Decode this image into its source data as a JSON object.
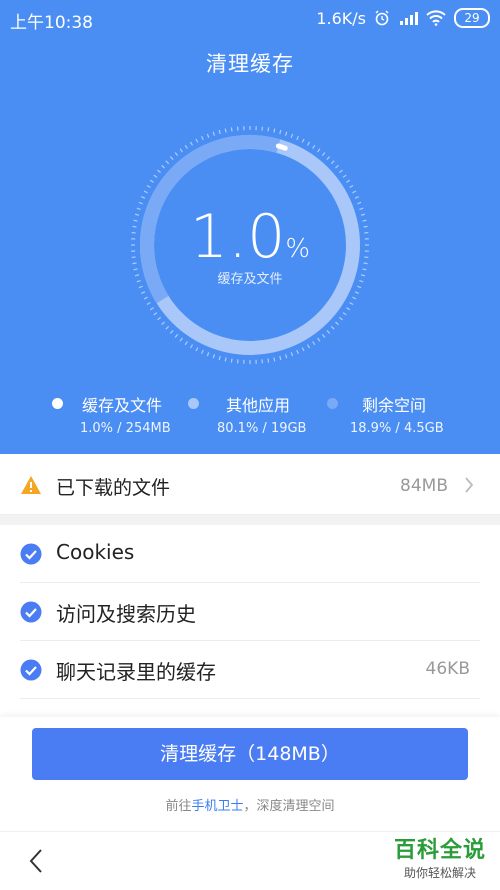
{
  "status": {
    "time": "上午10:38",
    "net_speed": "1.6K/s",
    "battery": "29"
  },
  "title": "清理缓存",
  "gauge": {
    "percent": "1.0",
    "percent_sign": "%",
    "label": "缓存及文件",
    "fill_fraction": 0.01
  },
  "legend": [
    {
      "name": "缓存及文件",
      "value": "1.0% / 254MB"
    },
    {
      "name": "其他应用",
      "value": "80.1% / 19GB"
    },
    {
      "name": "剩余空间",
      "value": "18.9% / 4.5GB"
    }
  ],
  "downloads": {
    "label": "已下载的文件",
    "size": "84MB"
  },
  "items": [
    {
      "label": "Cookies",
      "size": ""
    },
    {
      "label": "访问及搜索历史",
      "size": ""
    },
    {
      "label": "聊天记录里的缓存",
      "size": "46KB"
    },
    {
      "label": "",
      "size": ""
    }
  ],
  "clean_button": "清理缓存（148MB）",
  "hint": {
    "prefix": "前往",
    "link": "手机卫士",
    "suffix": "，深度清理空间"
  },
  "watermark": {
    "title": "百科全说",
    "subtitle": "助你轻松解决"
  },
  "colors": {
    "header": "#4a8ef4",
    "button": "#4a7df3",
    "accent": "#3b7cf2",
    "warning": "#f5a623"
  }
}
